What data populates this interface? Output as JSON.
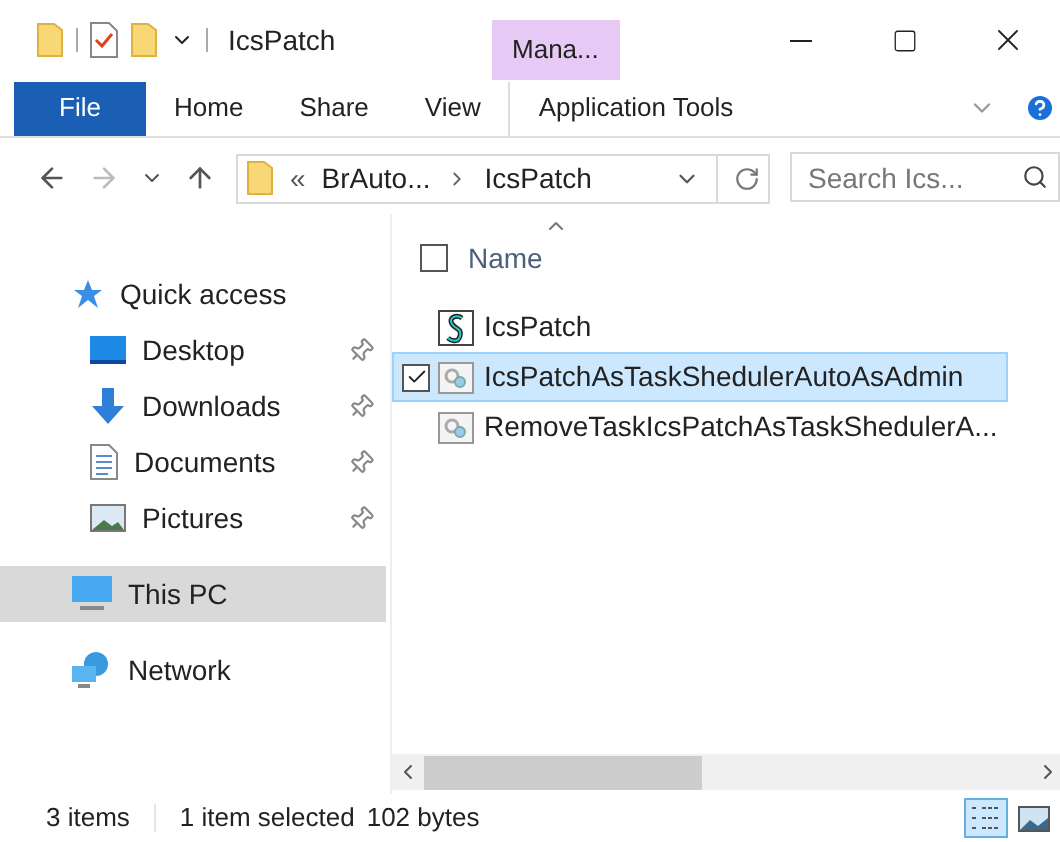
{
  "window": {
    "title": "IcsPatch",
    "context_tab": "Mana..."
  },
  "ribbon": {
    "tabs": [
      {
        "label": "File",
        "kind": "file"
      },
      {
        "label": "Home",
        "kind": "plain"
      },
      {
        "label": "Share",
        "kind": "plain"
      },
      {
        "label": "View",
        "kind": "plain"
      },
      {
        "label": "Application Tools",
        "kind": "context"
      }
    ]
  },
  "address": {
    "overflow": "«",
    "crumbs": [
      "BrAuto...",
      "IcsPatch"
    ],
    "search": {
      "placeholder": "Search Ics..."
    }
  },
  "nav": [
    {
      "label": "Quick access",
      "kind": "star",
      "selected": false,
      "children": [
        {
          "label": "Desktop",
          "kind": "desktop",
          "pinned": true,
          "selected": false
        },
        {
          "label": "Downloads",
          "kind": "download",
          "pinned": true,
          "selected": false
        },
        {
          "label": "Documents",
          "kind": "document",
          "pinned": true,
          "selected": false
        },
        {
          "label": "Pictures",
          "kind": "pictures",
          "pinned": true,
          "selected": false
        }
      ]
    },
    {
      "label": "This PC",
      "kind": "pc",
      "selected": true
    },
    {
      "label": "Network",
      "kind": "network",
      "selected": false
    }
  ],
  "files": {
    "columns": [
      "Name"
    ],
    "select_all": false,
    "rows": [
      {
        "name": "IcsPatch",
        "kind": "script",
        "selected": false,
        "checked": false
      },
      {
        "name": "IcsPatchAsTaskShedulerAutoAsAdmin",
        "kind": "task",
        "selected": true,
        "checked": true
      },
      {
        "name": "RemoveTaskIcsPatchAsTaskShedulerA...",
        "kind": "task",
        "selected": false,
        "checked": false
      }
    ]
  },
  "status_bar": {
    "count": "3 items",
    "selection": "1 item selected",
    "size": "102 bytes",
    "views": [
      {
        "kind": "details",
        "selected": true
      },
      {
        "kind": "thumbnails",
        "selected": false
      }
    ]
  }
}
